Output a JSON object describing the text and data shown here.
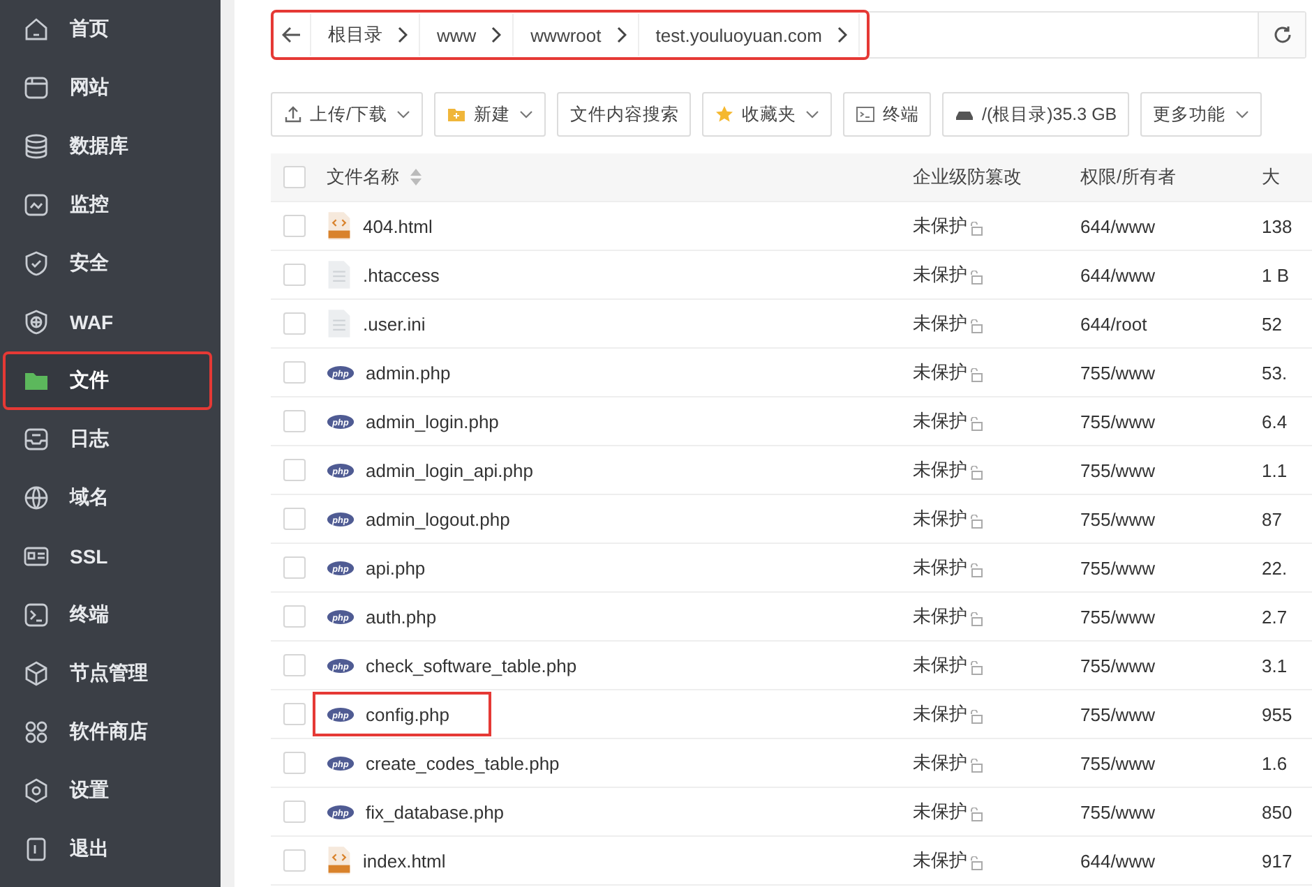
{
  "sidebar": {
    "items": [
      {
        "label": "首页",
        "selected": false,
        "highlighted": false
      },
      {
        "label": "网站",
        "selected": false,
        "highlighted": false
      },
      {
        "label": "数据库",
        "selected": false,
        "highlighted": false
      },
      {
        "label": "监控",
        "selected": false,
        "highlighted": false
      },
      {
        "label": "安全",
        "selected": false,
        "highlighted": false
      },
      {
        "label": "WAF",
        "selected": false,
        "highlighted": false
      },
      {
        "label": "文件",
        "selected": true,
        "highlighted": true
      },
      {
        "label": "日志",
        "selected": false,
        "highlighted": false
      },
      {
        "label": "域名",
        "selected": false,
        "highlighted": false
      },
      {
        "label": "SSL",
        "selected": false,
        "highlighted": false
      },
      {
        "label": "终端",
        "selected": false,
        "highlighted": false
      },
      {
        "label": "节点管理",
        "selected": false,
        "highlighted": false
      },
      {
        "label": "软件商店",
        "selected": false,
        "highlighted": false
      },
      {
        "label": "设置",
        "selected": false,
        "highlighted": false
      },
      {
        "label": "退出",
        "selected": false,
        "highlighted": false
      }
    ]
  },
  "breadcrumb": {
    "highlighted": true,
    "segments": [
      "根目录",
      "www",
      "wwwroot",
      "test.youluoyuan.com"
    ]
  },
  "toolbar": [
    {
      "label": "上传/下载",
      "dropdown": true
    },
    {
      "label": "新建",
      "dropdown": true
    },
    {
      "label": "文件内容搜索",
      "dropdown": false
    },
    {
      "label": "收藏夹",
      "dropdown": true
    },
    {
      "label": "终端",
      "dropdown": false
    },
    {
      "label": "/(根目录)35.3 GB",
      "dropdown": false
    },
    {
      "label": "更多功能",
      "dropdown": true
    }
  ],
  "table": {
    "columns": [
      "文件名称",
      "企业级防篡改",
      "权限/所有者",
      "大"
    ],
    "select_all_checked": false,
    "rows": [
      {
        "name": "404.html",
        "kind": "html",
        "checked": false,
        "protection": "未保护",
        "permission": "644/www",
        "size": "138",
        "highlighted": false
      },
      {
        "name": ".htaccess",
        "kind": "text",
        "checked": false,
        "protection": "未保护",
        "permission": "644/www",
        "size": "1 B",
        "highlighted": false
      },
      {
        "name": ".user.ini",
        "kind": "text",
        "checked": false,
        "protection": "未保护",
        "permission": "644/root",
        "size": "52",
        "highlighted": false
      },
      {
        "name": "admin.php",
        "kind": "php",
        "checked": false,
        "protection": "未保护",
        "permission": "755/www",
        "size": "53.",
        "highlighted": false
      },
      {
        "name": "admin_login.php",
        "kind": "php",
        "checked": false,
        "protection": "未保护",
        "permission": "755/www",
        "size": "6.4",
        "highlighted": false
      },
      {
        "name": "admin_login_api.php",
        "kind": "php",
        "checked": false,
        "protection": "未保护",
        "permission": "755/www",
        "size": "1.1",
        "highlighted": false
      },
      {
        "name": "admin_logout.php",
        "kind": "php",
        "checked": false,
        "protection": "未保护",
        "permission": "755/www",
        "size": "87",
        "highlighted": false
      },
      {
        "name": "api.php",
        "kind": "php",
        "checked": false,
        "protection": "未保护",
        "permission": "755/www",
        "size": "22.",
        "highlighted": false
      },
      {
        "name": "auth.php",
        "kind": "php",
        "checked": false,
        "protection": "未保护",
        "permission": "755/www",
        "size": "2.7",
        "highlighted": false
      },
      {
        "name": "check_software_table.php",
        "kind": "php",
        "checked": false,
        "protection": "未保护",
        "permission": "755/www",
        "size": "3.1",
        "highlighted": false
      },
      {
        "name": "config.php",
        "kind": "php",
        "checked": false,
        "protection": "未保护",
        "permission": "755/www",
        "size": "955",
        "highlighted": true
      },
      {
        "name": "create_codes_table.php",
        "kind": "php",
        "checked": false,
        "protection": "未保护",
        "permission": "755/www",
        "size": "1.6",
        "highlighted": false
      },
      {
        "name": "fix_database.php",
        "kind": "php",
        "checked": false,
        "protection": "未保护",
        "permission": "755/www",
        "size": "850",
        "highlighted": false
      },
      {
        "name": "index.html",
        "kind": "html",
        "checked": false,
        "protection": "未保护",
        "permission": "644/www",
        "size": "917",
        "highlighted": false
      }
    ]
  }
}
